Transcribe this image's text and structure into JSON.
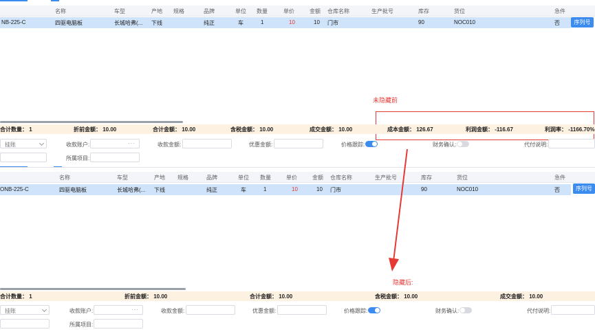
{
  "table": {
    "columns": [
      "名称",
      "车型",
      "产地",
      "规格",
      "品牌",
      "单位",
      "数量",
      "单价",
      "金额",
      "仓库名称",
      "生产批号",
      "库存",
      "货位",
      "急件"
    ],
    "row": {
      "code": "NB-225-C",
      "code2": "ONB-225-C",
      "name": "四驱电脑板",
      "car": "长城哈弗(...",
      "origin": "下线",
      "spec": "",
      "brand": "纯正",
      "unit": "车",
      "qty": "1",
      "price": "10",
      "amount": "10",
      "warehouse": "门市",
      "batch": "",
      "stock": "90",
      "location": "NOC010",
      "urgent": "否",
      "seq_button": "序列号"
    }
  },
  "summary_top": {
    "total_qty": "合计数量： 1",
    "pre_discount": "折前金额： 10.00",
    "total_amount": "合计金额： 10.00",
    "tax_amount": "含税金额： 10.00",
    "deal_amount": "成交金额： 10.00",
    "cost_amount": "成本金额： 126.67",
    "profit_amount": "利润金额： -116.67",
    "profit_rate": "利润率： -1166.70%"
  },
  "summary_bottom": {
    "total_qty": "合计数量： 1",
    "pre_discount": "折前金额： 10.00",
    "total_amount": "合计金额： 10.00",
    "tax_amount": "含税金额： 10.00",
    "deal_amount": "成交金额： 10.00"
  },
  "form": {
    "account_type": "挂账",
    "receive_account": "收款账户:",
    "receive_amount": "收款金额:",
    "discount_amount": "优惠金额:",
    "price_tracking": "价格跟踪:",
    "finance_confirm": "财务确认:",
    "pay_note": "代付说明:",
    "project": "所属项目:",
    "dots": "···"
  },
  "annotations": {
    "before": "未隐藏前",
    "after": "隐藏后:"
  },
  "colors": {
    "accent": "#3c8cf0",
    "selected_row": "#cfe3fa",
    "summary_bg": "#fdf1e2",
    "annotation": "#e53935"
  }
}
